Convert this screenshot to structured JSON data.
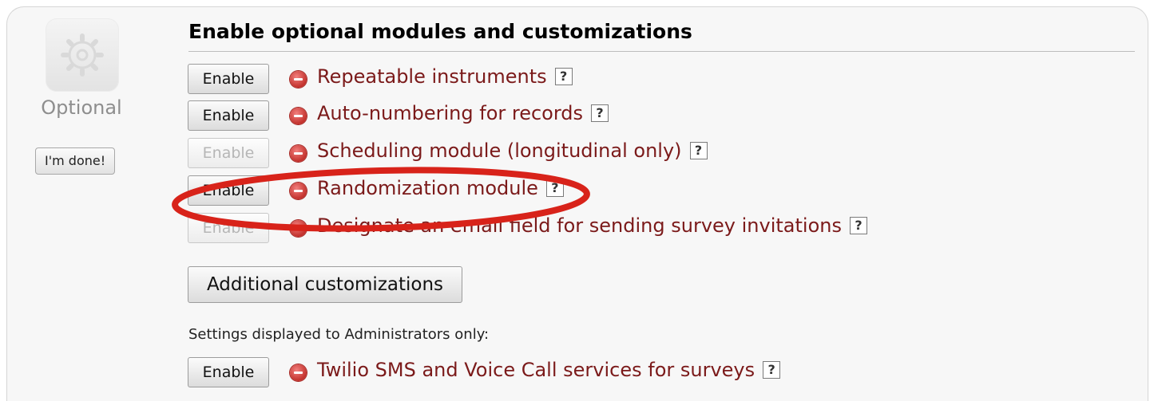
{
  "sidebar": {
    "icon": "gear-icon",
    "label": "Optional",
    "done_button": "I'm done!"
  },
  "section": {
    "title": "Enable optional modules and customizations"
  },
  "modules": [
    {
      "button": "Enable",
      "label": "Repeatable instruments",
      "help": "?",
      "button_disabled": false
    },
    {
      "button": "Enable",
      "label": "Auto-numbering for records",
      "help": "?",
      "button_disabled": false
    },
    {
      "button": "Enable",
      "label": "Scheduling module (longitudinal only)",
      "help": "?",
      "button_disabled": true
    },
    {
      "button": "Enable",
      "label": "Randomization module",
      "help": "?",
      "button_disabled": false
    },
    {
      "button": "Enable",
      "label": "Designate an email field for sending survey invitations",
      "help": "?",
      "button_disabled": true
    }
  ],
  "additional_button": "Additional customizations",
  "admin": {
    "note": "Settings displayed to Administrators only:",
    "module": {
      "button": "Enable",
      "label": "Twilio SMS and Voice Call services for surveys",
      "help": "?"
    }
  },
  "colors": {
    "module_label": "#7b1a1a",
    "disable_icon": "#c3322d",
    "highlight_ellipse": "#d8231a"
  }
}
